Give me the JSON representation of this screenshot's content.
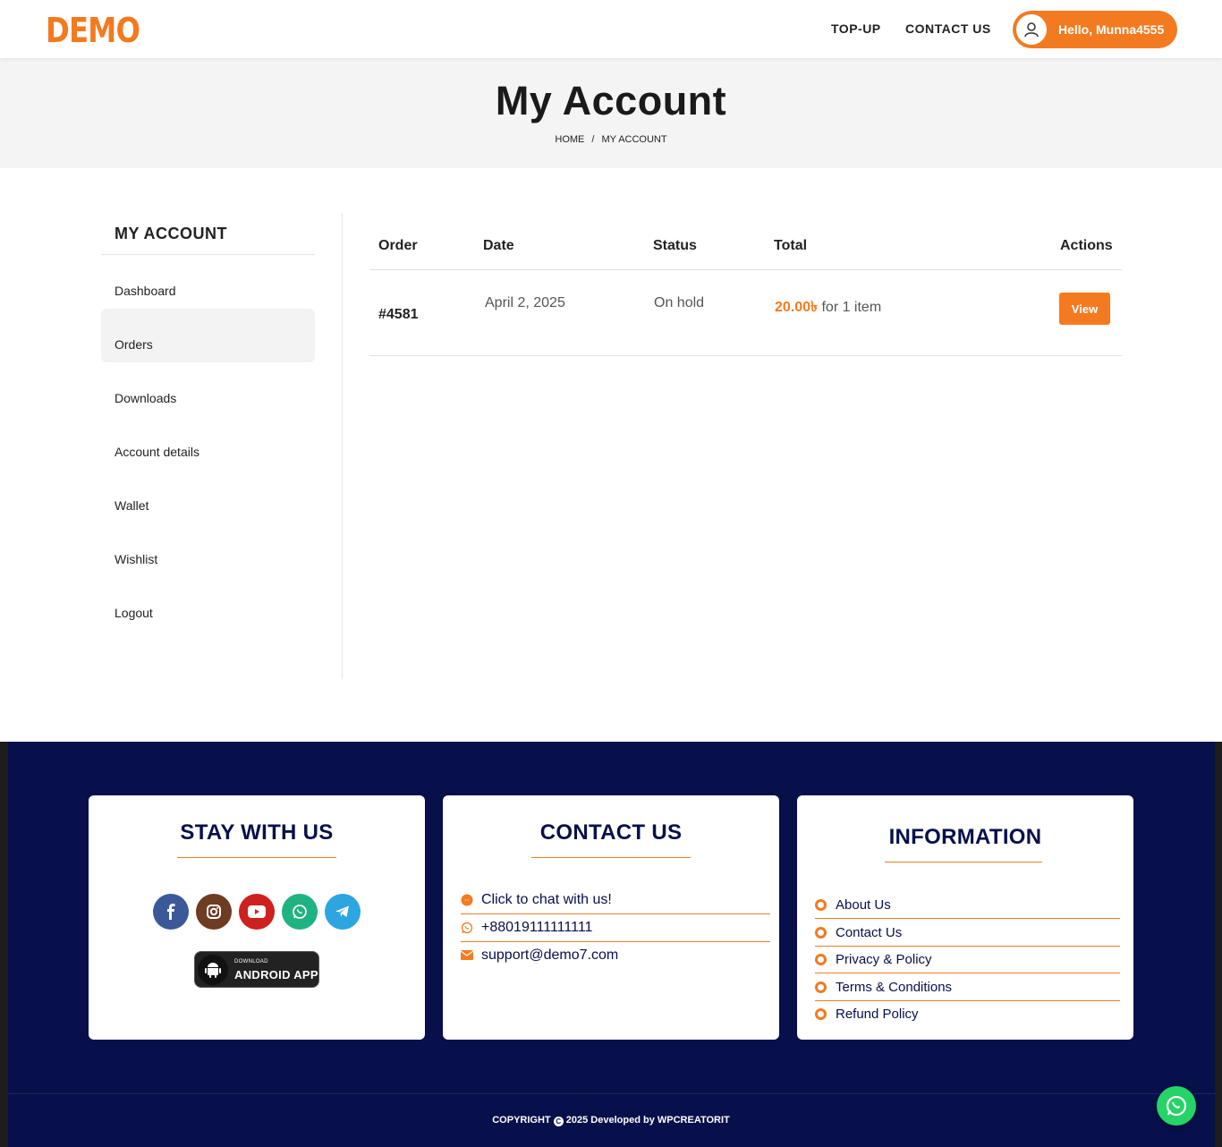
{
  "header": {
    "logo": "DEMO",
    "nav": [
      "TOP-UP",
      "CONTACT US"
    ],
    "greeting": "Hello, Munna4555"
  },
  "hero": {
    "title": "My Account",
    "breadcrumb": [
      "HOME",
      "/",
      "MY ACCOUNT"
    ]
  },
  "sidebar": {
    "heading": "MY ACCOUNT",
    "items": [
      {
        "label": "Dashboard",
        "active": false
      },
      {
        "label": "Orders",
        "active": true
      },
      {
        "label": "Downloads",
        "active": false
      },
      {
        "label": "Account details",
        "active": false
      },
      {
        "label": "Wallet",
        "active": false
      },
      {
        "label": "Wishlist",
        "active": false
      },
      {
        "label": "Logout",
        "active": false
      }
    ]
  },
  "orders": {
    "columns": [
      "Order",
      "Date",
      "Status",
      "Total",
      "Actions"
    ],
    "rows": [
      {
        "order": "#4581",
        "date": "April 2, 2025",
        "status": "On hold",
        "amount": "20.00৳",
        "items": "for 1 item",
        "action": "View"
      }
    ]
  },
  "footer": {
    "stay": {
      "title": "STAY WITH US",
      "socials": [
        {
          "icon": "facebook-icon",
          "color": "#3b5998"
        },
        {
          "icon": "instagram-icon",
          "color": "#6e3b23"
        },
        {
          "icon": "youtube-icon",
          "color": "#cd201f"
        },
        {
          "icon": "whatsapp-icon",
          "color": "#1fb381"
        },
        {
          "icon": "telegram-icon",
          "color": "#2ca5e0"
        }
      ],
      "app_small": "DOWNLOAD",
      "app_big": "ANDROID APP"
    },
    "contact": {
      "title": "CONTACT US",
      "lines": [
        {
          "icon": "messenger-icon",
          "text": "Click to chat with us!"
        },
        {
          "icon": "whatsapp-icon",
          "text": "+88019111111111"
        },
        {
          "icon": "envelope-icon",
          "text": "support@demo7.com"
        }
      ]
    },
    "info": {
      "title": "INFORMATION",
      "links": [
        "About Us",
        "Contact Us",
        "Privacy & Policy",
        "Terms & Conditions",
        "Refund Policy"
      ]
    },
    "copyright_pre": "COPYRIGHT",
    "copyright_symbol": "C",
    "copyright_post": "2025 Developed by WPCREATORIT"
  },
  "colors": {
    "accent": "#f47a1f",
    "footer_bg": "#07104a"
  }
}
